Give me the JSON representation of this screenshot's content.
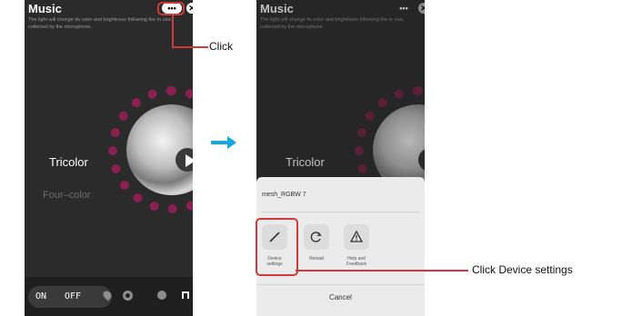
{
  "left_screen": {
    "title": "Music",
    "description": "The light will change its color and brightness following the m usic collected by the microphone.",
    "more_label": "•••",
    "close_label": "✕",
    "mode_active": "Tricolor",
    "mode_inactive": "Four–color",
    "on_label": "ON",
    "off_label": "OFF"
  },
  "right_screen": {
    "title": "Music",
    "description": "The light will change its color and brightness following the m usic collected by the microphone.",
    "more_label": "•••",
    "close_label": "✕",
    "mode_active": "Tricolor",
    "sheet": {
      "device_name": "mesh_RGBW 7",
      "actions": [
        {
          "label": "Device settings"
        },
        {
          "label": "Reload"
        },
        {
          "label": "Help and Feedback"
        }
      ],
      "cancel_label": "Cancel"
    }
  },
  "callouts": {
    "click": "Click",
    "click_device_settings": "Click Device settings"
  },
  "colors": {
    "highlight": "#d13a3a",
    "arrow": "#12a7e0",
    "ring": "#8a1f52"
  }
}
